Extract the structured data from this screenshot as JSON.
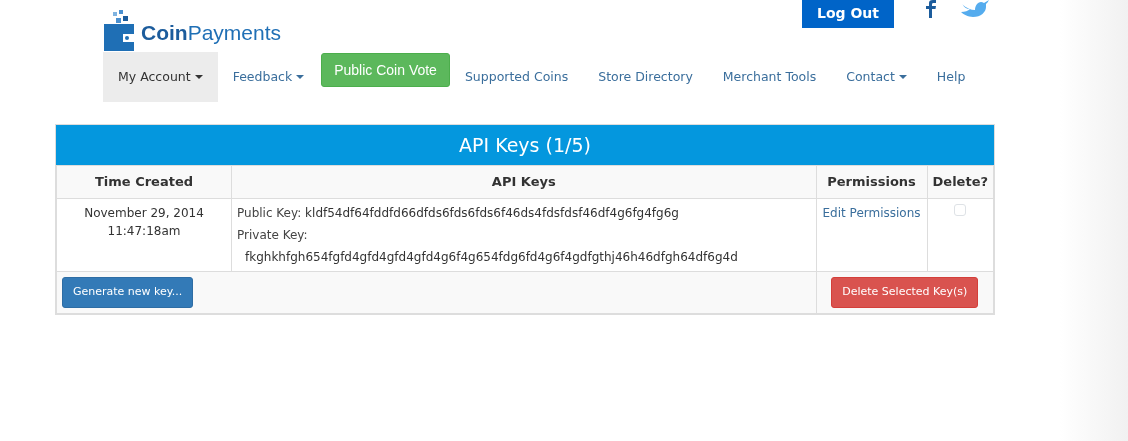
{
  "header": {
    "logo": {
      "bold": "Coin",
      "light": "Payments"
    },
    "logout_button": "Log Out"
  },
  "nav": [
    {
      "label": "My Account",
      "kind": "dropdown",
      "selected": true
    },
    {
      "label": "Feedback",
      "kind": "dropdown",
      "selected": false
    },
    {
      "label": "Public Coin Vote",
      "kind": "button",
      "selected": false
    },
    {
      "label": "Supported Coins",
      "kind": "link",
      "selected": false
    },
    {
      "label": "Store Directory",
      "kind": "link",
      "selected": false
    },
    {
      "label": "Merchant Tools",
      "kind": "link",
      "selected": false
    },
    {
      "label": "Contact",
      "kind": "dropdown",
      "selected": false
    },
    {
      "label": "Help",
      "kind": "link",
      "selected": false
    }
  ],
  "panel": {
    "title": "API Keys (1/5)",
    "table": {
      "columns": [
        "Time Created",
        "API Keys",
        "Permissions",
        "Delete?"
      ],
      "rows": [
        {
          "date": "November 29, 2014",
          "time": "11:47:18am",
          "public_label": "Public Key:",
          "public_key": "kldf54df64fddfd66dfds6fds6fds6f46ds4fdsfdsf46df4g6fg4fg6g",
          "private_label": "Private Key:",
          "private_key": "fkghkhfgh654fgfd4gfd4gfd4gfd4g6f4g654fdg6fd4g6f4gdfgthj46h46dfgh64df6g4d",
          "permissions_link": "Edit Permissions",
          "checked": false
        }
      ]
    },
    "generate_button": "Generate new key...",
    "delete_button": "Delete Selected Key(s)"
  }
}
